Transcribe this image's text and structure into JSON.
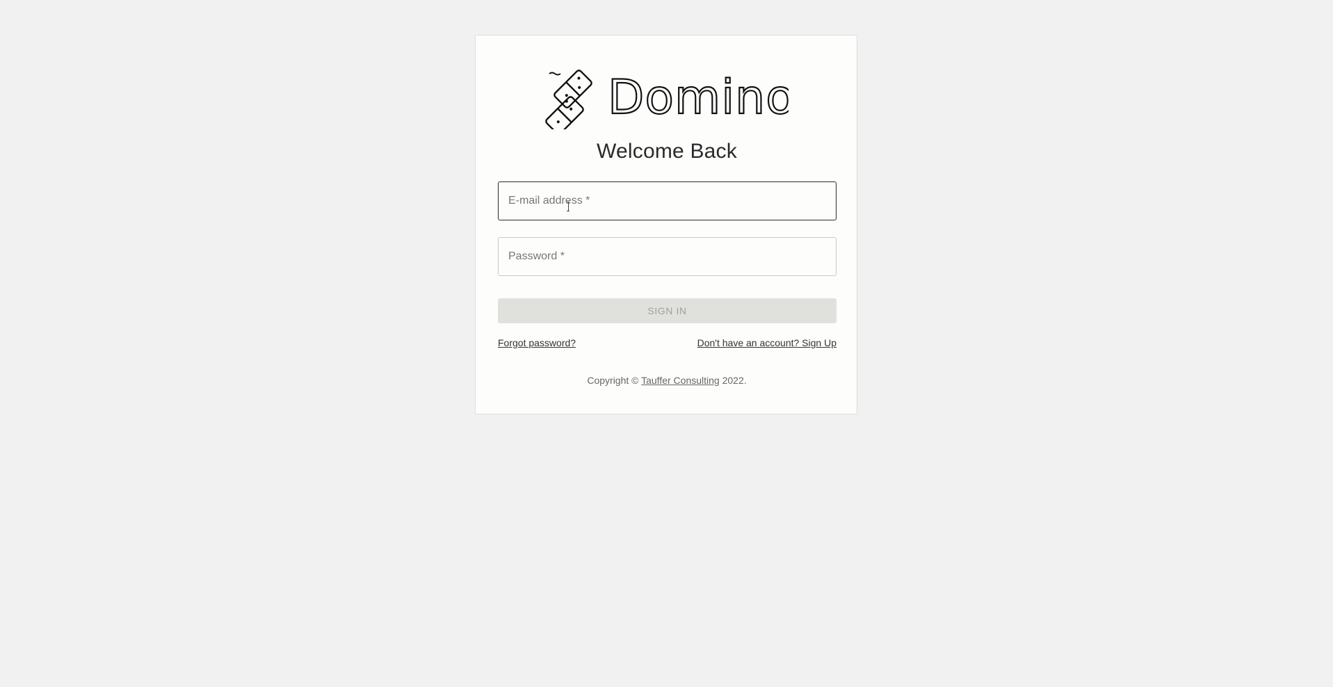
{
  "brand": {
    "name": "Domino",
    "logo_icon": "domino-tiles-icon"
  },
  "login": {
    "title": "Welcome Back",
    "email_placeholder": "E-mail address *",
    "password_placeholder": "Password *",
    "signin_label": "SIGN IN",
    "forgot_password": "Forgot password?",
    "signup_link": "Don't have an account? Sign Up"
  },
  "footer": {
    "prefix": "Copyright © ",
    "company": "Tauffer Consulting",
    "suffix": " 2022."
  },
  "colors": {
    "background": "#f0f1f0",
    "card": "#fdfdfc",
    "button_disabled": "#e0e0dd"
  }
}
